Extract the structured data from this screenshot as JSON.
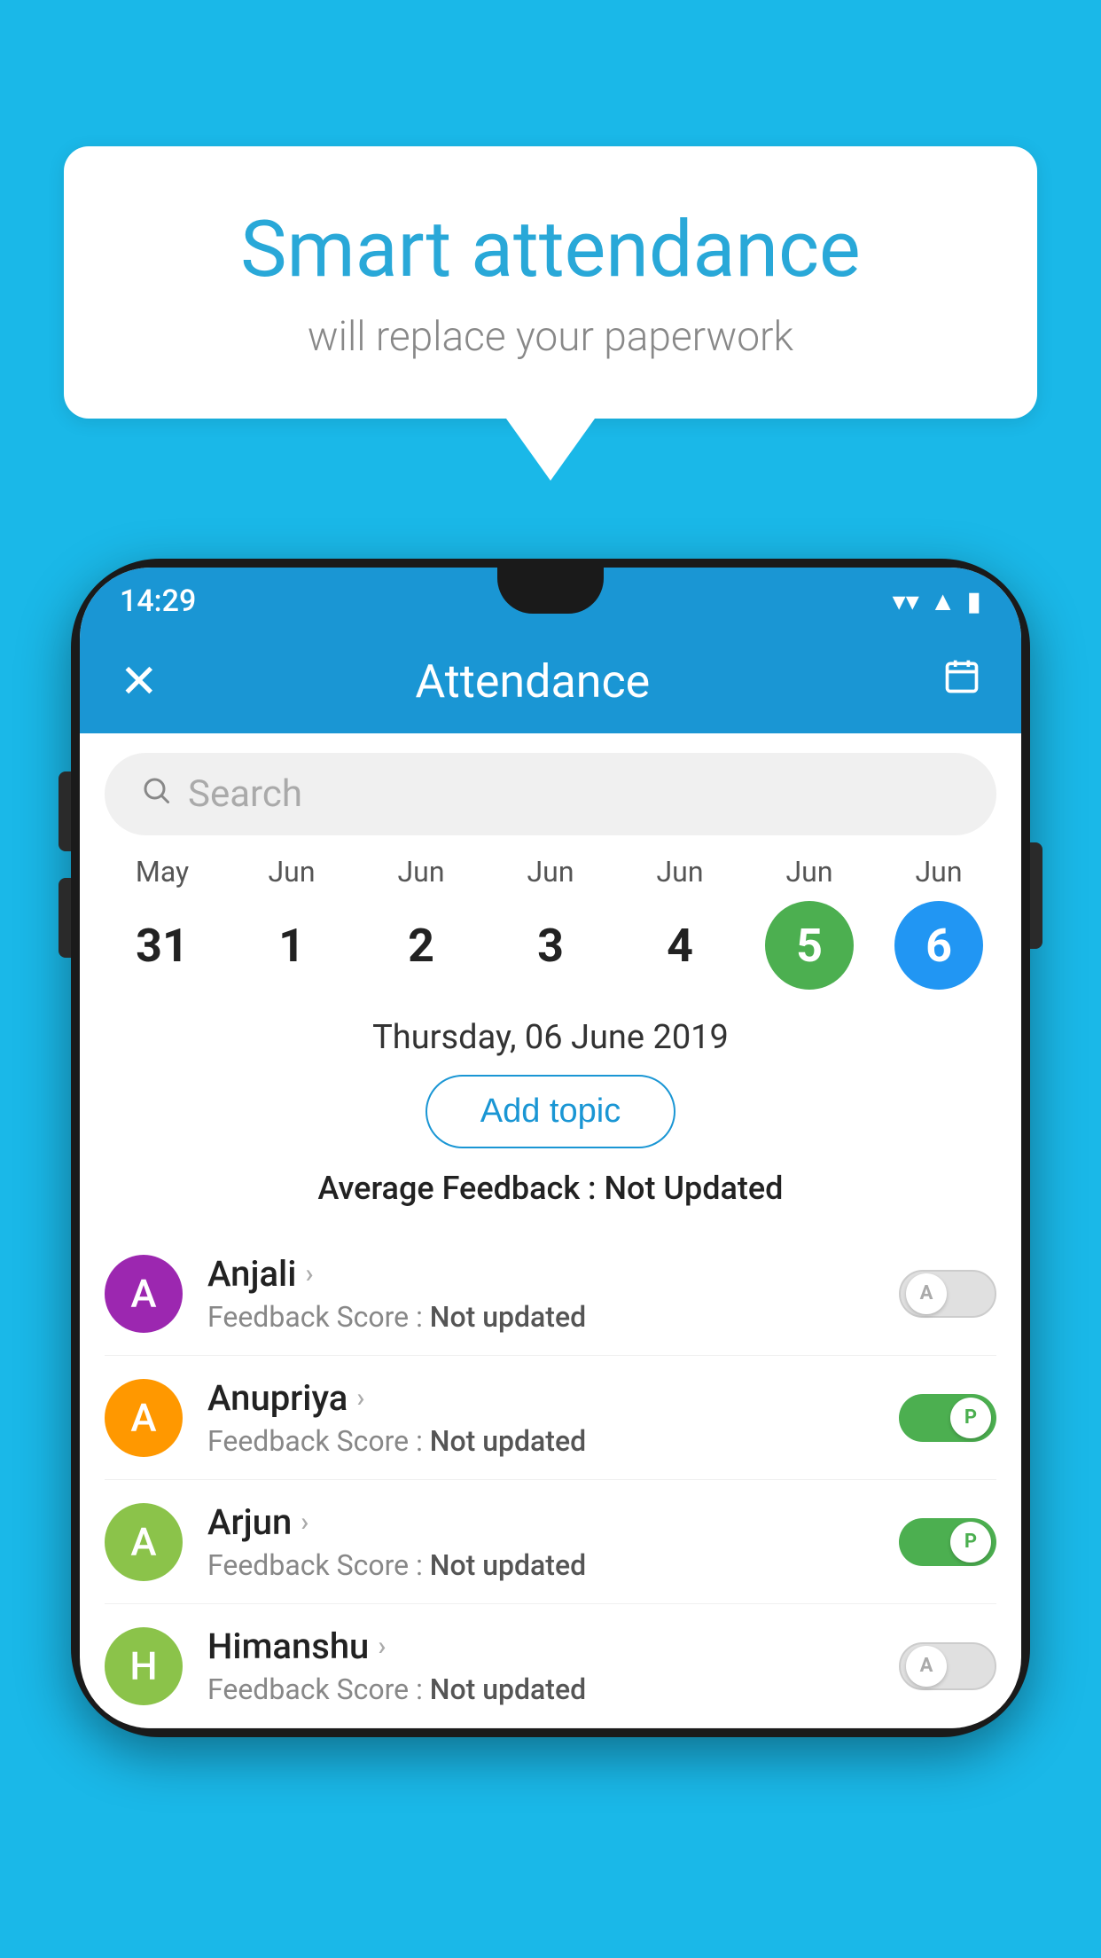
{
  "background_color": "#1ab8e8",
  "speech_bubble": {
    "title": "Smart attendance",
    "subtitle": "will replace your paperwork"
  },
  "phone": {
    "status_bar": {
      "time": "14:29",
      "wifi": "▼",
      "signal": "▲",
      "battery": "▮"
    },
    "app_bar": {
      "title": "Attendance",
      "close_label": "✕",
      "calendar_label": "📅"
    },
    "search": {
      "placeholder": "Search"
    },
    "calendar": {
      "days": [
        {
          "month": "May",
          "num": "31",
          "state": "normal"
        },
        {
          "month": "Jun",
          "num": "1",
          "state": "normal"
        },
        {
          "month": "Jun",
          "num": "2",
          "state": "normal"
        },
        {
          "month": "Jun",
          "num": "3",
          "state": "normal"
        },
        {
          "month": "Jun",
          "num": "4",
          "state": "normal"
        },
        {
          "month": "Jun",
          "num": "5",
          "state": "today"
        },
        {
          "month": "Jun",
          "num": "6",
          "state": "selected"
        }
      ]
    },
    "selected_date": "Thursday, 06 June 2019",
    "add_topic_label": "Add topic",
    "avg_feedback_label": "Average Feedback : ",
    "avg_feedback_value": "Not Updated",
    "students": [
      {
        "name": "Anjali",
        "avatar_letter": "A",
        "avatar_color": "#9c27b0",
        "feedback_label": "Feedback Score : ",
        "feedback_value": "Not updated",
        "toggle_state": "off",
        "toggle_letter": "A"
      },
      {
        "name": "Anupriya",
        "avatar_letter": "A",
        "avatar_color": "#ff9800",
        "feedback_label": "Feedback Score : ",
        "feedback_value": "Not updated",
        "toggle_state": "on",
        "toggle_letter": "P"
      },
      {
        "name": "Arjun",
        "avatar_letter": "A",
        "avatar_color": "#8bc34a",
        "feedback_label": "Feedback Score : ",
        "feedback_value": "Not updated",
        "toggle_state": "on",
        "toggle_letter": "P"
      },
      {
        "name": "Himanshu",
        "avatar_letter": "H",
        "avatar_color": "#8bc34a",
        "feedback_label": "Feedback Score : ",
        "feedback_value": "Not updated",
        "toggle_state": "off",
        "toggle_letter": "A"
      }
    ]
  }
}
